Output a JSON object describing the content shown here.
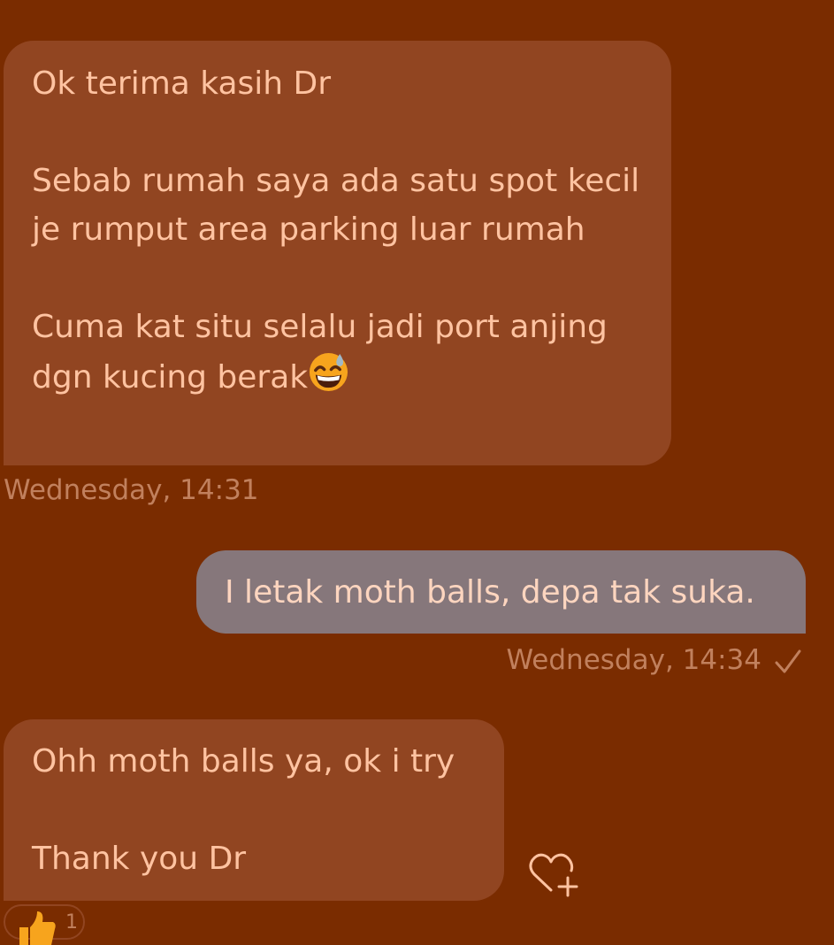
{
  "messages": [
    {
      "direction": "incoming",
      "text": "Ok terima kasih Dr\n\nSebab rumah saya ada satu spot kecil je rumput area parking luar rumah\n\nCuma kat situ selalu jadi port anjing dgn kucing berak",
      "emoji": "grinning-face-with-sweat-icon",
      "timestamp": "Wednesday, 14:31"
    },
    {
      "direction": "outgoing",
      "text": "I letak moth balls, depa tak suka.",
      "timestamp": "Wednesday, 14:34",
      "status_icon": "checkmark-icon"
    },
    {
      "direction": "incoming",
      "text": "Ohh moth balls ya, ok i try\n\nThank you Dr",
      "react_icon": "heart-add-icon",
      "reaction": {
        "icon": "thumbs-up-icon",
        "count": "1"
      }
    }
  ],
  "colors": {
    "background": "#7a2c00",
    "incoming_bubble": "#914521",
    "incoming_text": "#ffc3a1",
    "outgoing_bubble": "#86777b",
    "outgoing_text": "#fdd5bf",
    "timestamp": "#c1805d"
  }
}
